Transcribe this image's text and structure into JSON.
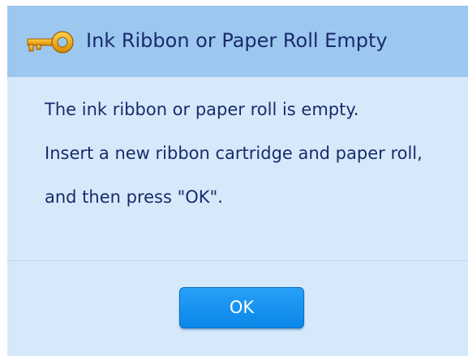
{
  "dialog": {
    "title": "Ink Ribbon or Paper Roll Empty",
    "icon": "key-icon",
    "message_lines": [
      "The ink ribbon or paper roll is empty.",
      "Insert a new ribbon cartridge and paper roll,",
      "and then press \"OK\"."
    ],
    "ok_label": "OK"
  },
  "colors": {
    "header_background": "#9cc8f0",
    "body_background": "#d6e9fb",
    "text": "#1a2a6b",
    "button": "#1594f0",
    "icon": "#e8a317"
  }
}
